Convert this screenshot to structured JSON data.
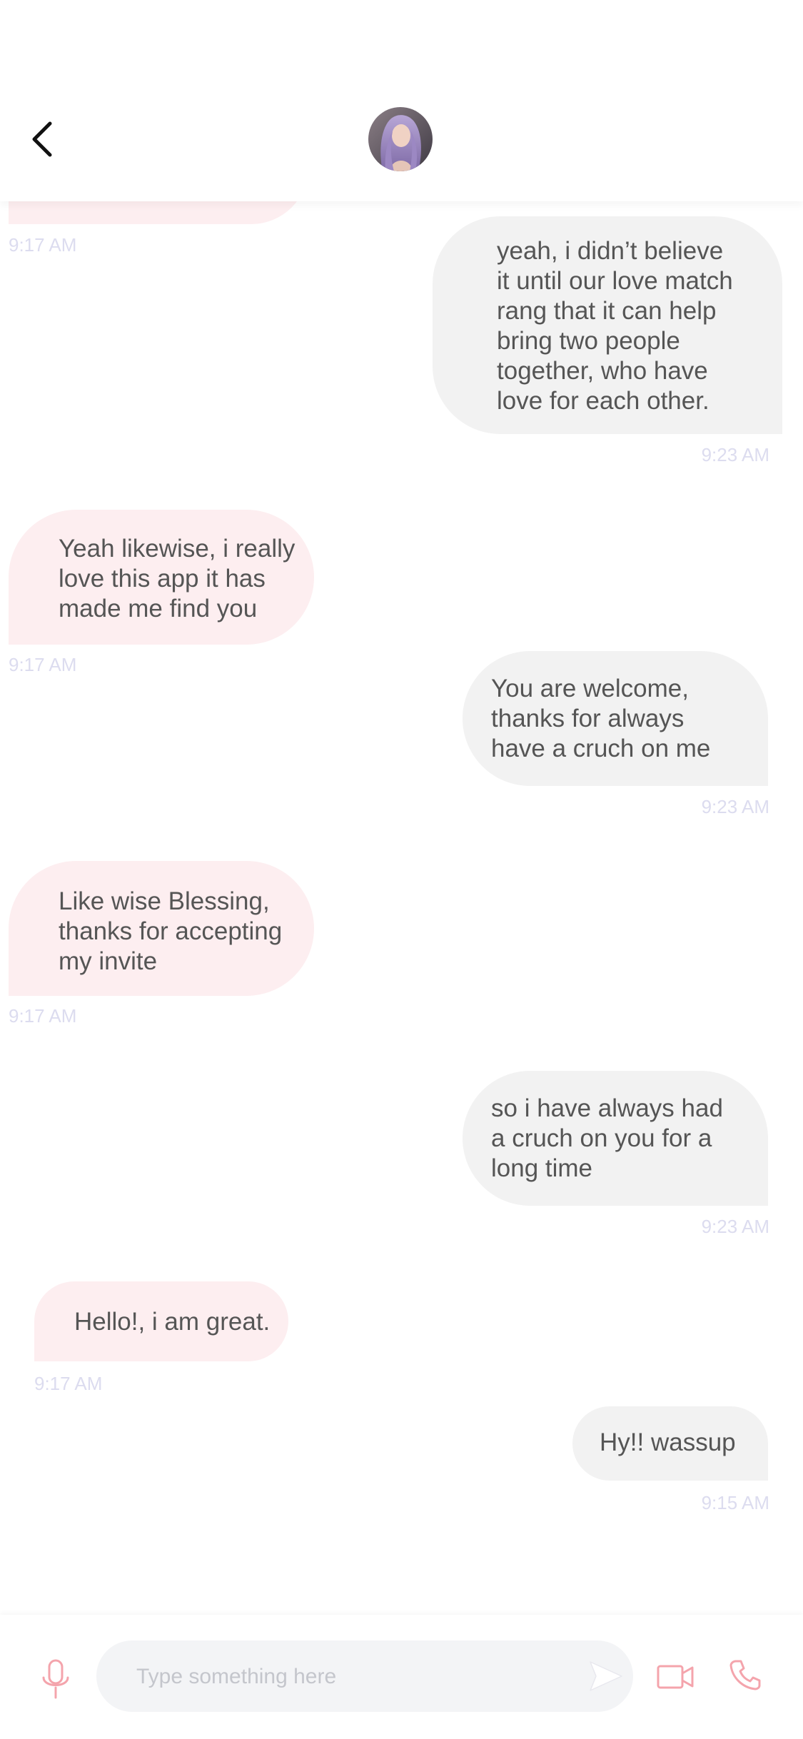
{
  "colors": {
    "incoming_bubble": "#fdeef0",
    "outgoing_bubble": "#f2f2f2",
    "accent": "#f4a4ac",
    "timestamp": "#dcdcef"
  },
  "header": {
    "back_icon": "chevron-left-icon",
    "avatar_icon": "profile-avatar"
  },
  "messages": [
    {
      "direction": "in",
      "lines": [],
      "time": "9:17 AM"
    },
    {
      "direction": "out",
      "lines": [
        "yeah, i didn’t believe",
        "it until our love match",
        "rang that it can help",
        "bring two people",
        "together, who have",
        "love for each other."
      ],
      "time": "9:23 AM"
    },
    {
      "direction": "in",
      "lines": [
        "Yeah likewise, i really",
        "love this app it has",
        "made me find you"
      ],
      "time": "9:17 AM"
    },
    {
      "direction": "out",
      "lines": [
        "You are welcome,",
        "thanks for always",
        "have a cruch on me"
      ],
      "time": "9:23 AM"
    },
    {
      "direction": "in",
      "lines": [
        "Like wise Blessing,",
        "thanks for accepting",
        "my invite"
      ],
      "time": "9:17 AM"
    },
    {
      "direction": "out",
      "lines": [
        "so i have always had",
        "a cruch on you for a",
        "long time"
      ],
      "time": "9:23 AM"
    },
    {
      "direction": "in",
      "lines": [
        "Hello!, i am great."
      ],
      "time": "9:17 AM"
    },
    {
      "direction": "out",
      "lines": [
        "Hy!! wassup"
      ],
      "time": "9:15 AM"
    }
  ],
  "composer": {
    "placeholder": "Type something here",
    "value": "",
    "mic_icon": "microphone-icon",
    "send_icon": "send-icon",
    "video_icon": "video-camera-icon",
    "phone_icon": "phone-icon"
  }
}
